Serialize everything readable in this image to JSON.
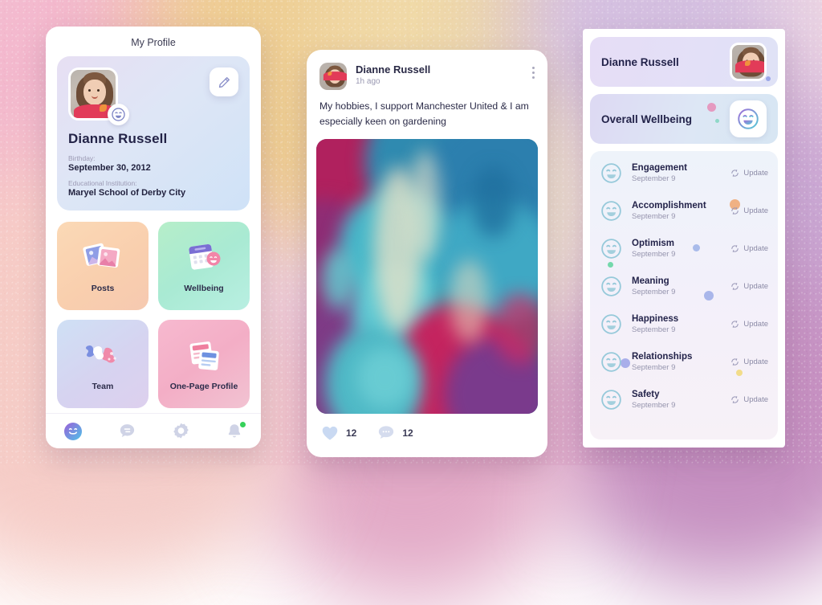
{
  "background": {
    "palette": [
      "#f3b8cd",
      "#eecd92",
      "#d4bfe0",
      "#c58fc0",
      "#f4cdc9"
    ]
  },
  "left_phone": {
    "page_title": "My Profile",
    "profile": {
      "avatar_icon": "user-photo",
      "status_emoji_icon": "smiley-icon",
      "edit_icon": "pencil-icon",
      "name": "Dianne Russell",
      "birthday_label": "Birthday:",
      "birthday_value": "September 30, 2012",
      "school_label": "Educational Institution:",
      "school_value": "Maryel School of Derby City"
    },
    "tiles": [
      {
        "label": "Posts",
        "icon": "photos-icon",
        "theme": "t-posts"
      },
      {
        "label": "Wellbeing",
        "icon": "calendar-smiley-icon",
        "theme": "t-well"
      },
      {
        "label": "Team",
        "icon": "puzzle-icon",
        "theme": "t-team"
      },
      {
        "label": "One-Page Profile",
        "icon": "documents-icon",
        "theme": "t-onepage"
      }
    ],
    "nav": [
      {
        "name": "profile",
        "icon": "smiley-face-icon",
        "active": true,
        "badge": false
      },
      {
        "name": "messages",
        "icon": "chat-bubble-icon",
        "active": false,
        "badge": false
      },
      {
        "name": "settings",
        "icon": "gear-icon",
        "active": false,
        "badge": false
      },
      {
        "name": "notifications",
        "icon": "bell-icon",
        "active": false,
        "badge": true
      }
    ]
  },
  "middle_phone": {
    "post": {
      "avatar_icon": "user-photo",
      "author": "Dianne Russell",
      "time": "1h ago",
      "menu_icon": "kebab-menu-icon",
      "text": "My hobbies, I support Manchester United & I am especially keen on gardening",
      "image_alt": "marbled-acrylic-pour-artwork",
      "like_icon": "heart-icon",
      "like_count": "12",
      "comment_icon": "comment-icon",
      "comment_count": "12"
    }
  },
  "right_phone": {
    "name_card": {
      "title": "Dianne Russell",
      "avatar_icon": "user-photo"
    },
    "wellbeing_card": {
      "title": "Overall Wellbeing",
      "emoji_icon": "smiley-icon"
    },
    "update_label": "Update",
    "update_icon": "refresh-icon",
    "items": [
      {
        "title": "Engagement",
        "date": "September 9",
        "emoji_icon": "smiley-icon"
      },
      {
        "title": "Accomplishment",
        "date": "September 9",
        "emoji_icon": "smiley-icon"
      },
      {
        "title": "Optimism",
        "date": "September 9",
        "emoji_icon": "smiley-icon"
      },
      {
        "title": "Meaning",
        "date": "September 9",
        "emoji_icon": "smiley-icon"
      },
      {
        "title": "Happiness",
        "date": "September 9",
        "emoji_icon": "smiley-icon"
      },
      {
        "title": "Relationships",
        "date": "September 9",
        "emoji_icon": "smiley-icon"
      },
      {
        "title": "Safety",
        "date": "September 9",
        "emoji_icon": "smiley-icon"
      }
    ]
  }
}
